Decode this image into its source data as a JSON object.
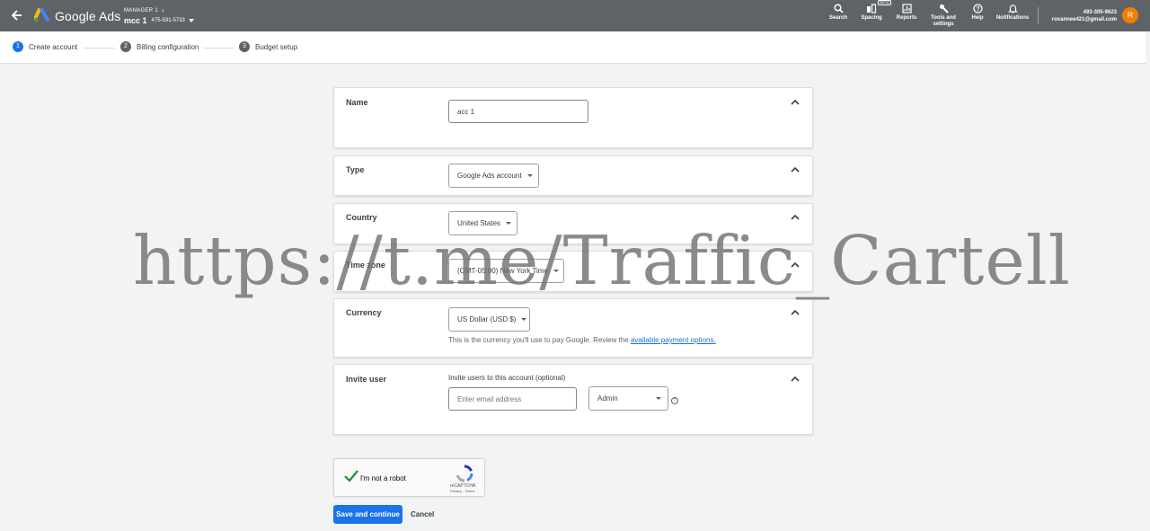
{
  "app": {
    "name": "Google Ads"
  },
  "account": {
    "manager_label": "MANAGER 1",
    "name": "mcc 1",
    "id": "475-591-5733"
  },
  "toolbar": {
    "search": "Search",
    "spacing": "Spacing",
    "beta": "BETA",
    "reports": "Reports",
    "tools_line1": "Tools and",
    "tools_line2": "settings",
    "help": "Help",
    "notifications": "Notifications"
  },
  "user": {
    "phone": "493-305-9623",
    "email": "roxannee421@gmail.com",
    "initial": "R",
    "avatar_color": "#f57c00"
  },
  "steps": [
    {
      "num": "1",
      "label": "Create account"
    },
    {
      "num": "2",
      "label": "Billing configuration"
    },
    {
      "num": "3",
      "label": "Budget setup"
    }
  ],
  "form": {
    "name": {
      "label": "Name",
      "value": "acc 1"
    },
    "type": {
      "label": "Type",
      "value": "Google Ads account"
    },
    "country": {
      "label": "Country",
      "value": "United States"
    },
    "timezone": {
      "label": "Time zone",
      "value": "(GMT-05:00) New York Time"
    },
    "currency": {
      "label": "Currency",
      "value": "US Dollar (USD $)",
      "hint": "This is the currency you'll use to pay Google. Review the ",
      "hint_link": "available payment options."
    },
    "invite": {
      "label": "Invite user",
      "subtitle": "Invite users to this account (optional)",
      "email_placeholder": "Enter email address",
      "role": "Admin",
      "help": "?"
    }
  },
  "captcha": {
    "label": "I'm not a robot",
    "brand": "reCAPTCHA",
    "links": "Privacy - Terms"
  },
  "actions": {
    "save": "Save and continue",
    "cancel": "Cancel"
  },
  "watermark": "https://t.me/Traffic_Cartell",
  "colors": {
    "topbar": "#5f6368",
    "primary": "#1a73e8",
    "background": "#f1f3f4"
  }
}
